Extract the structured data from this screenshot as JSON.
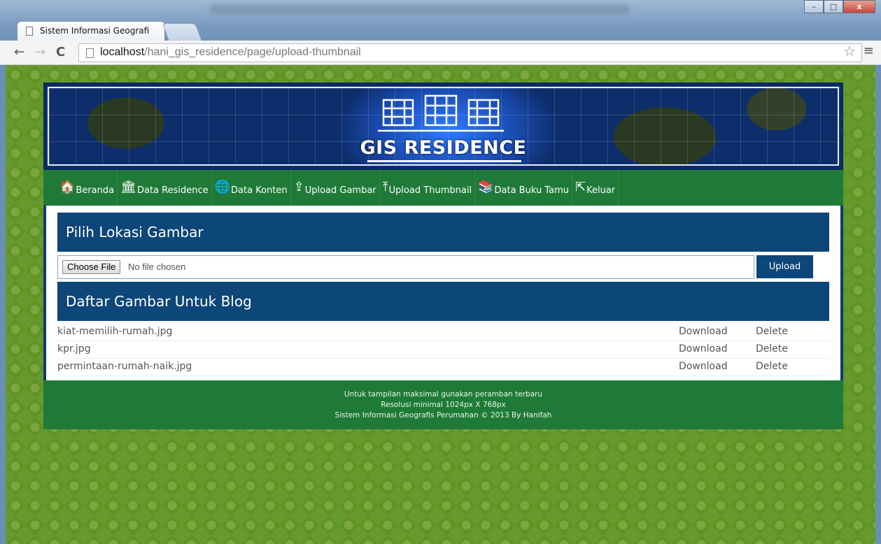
{
  "browser": {
    "tab_title": "Sistem Informasi Geografi",
    "tab_close": "×",
    "url_host": "localhost",
    "url_path": "/hani_gis_residence/page/upload-thumbnail",
    "window_buttons": {
      "minimize": "–",
      "maximize": "□",
      "close": "x"
    }
  },
  "banner": {
    "title": "GIS RESIDENCE"
  },
  "menu": {
    "items": [
      {
        "label": "Beranda",
        "icon": "home-icon",
        "glyph": "🏠"
      },
      {
        "label": "Data Residence",
        "icon": "bank-icon",
        "glyph": "🏛"
      },
      {
        "label": "Data Konten",
        "icon": "globe-icon",
        "glyph": "🌐"
      },
      {
        "label": "Upload Gambar",
        "icon": "cloud-upload-icon",
        "glyph": "⇪"
      },
      {
        "label": "Upload Thumbnail",
        "icon": "upload-icon",
        "glyph": "⤒"
      },
      {
        "label": "Data Buku Tamu",
        "icon": "books-icon",
        "glyph": "📚"
      },
      {
        "label": "Keluar",
        "icon": "logout-icon",
        "glyph": "⇱"
      }
    ]
  },
  "upload": {
    "heading": "Pilih Lokasi Gambar",
    "choose_label": "Choose File",
    "no_file": "No file chosen",
    "button": "Upload"
  },
  "list": {
    "heading": "Daftar Gambar Untuk Blog",
    "files": [
      {
        "name": "kiat-memilih-rumah.jpg",
        "download": "Download",
        "delete": "Delete"
      },
      {
        "name": "kpr.jpg",
        "download": "Download",
        "delete": "Delete"
      },
      {
        "name": "permintaan-rumah-naik.jpg",
        "download": "Download",
        "delete": "Delete"
      }
    ]
  },
  "footer": {
    "line1": "Untuk tampilan maksimal gunakan peramban terbaru",
    "line2": "Resolusi minimal 1024px X 768px",
    "line3": "Sistem Informasi Geografis Perumahan © 2013 By Hanifah"
  },
  "colors": {
    "menu_green": "#1f7a38",
    "panel_blue": "#0d4678",
    "page_green": "#5f9322"
  }
}
